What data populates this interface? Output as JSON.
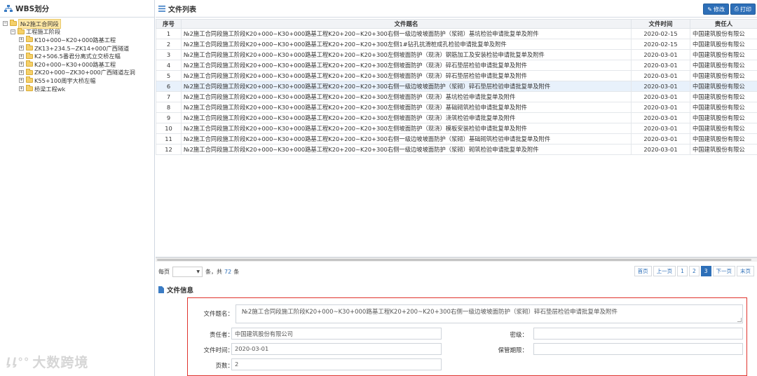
{
  "left": {
    "title": "WBS划分",
    "tree": {
      "root": "№2施工合同段",
      "child": "工程施工阶段",
      "items": [
        "K10+000~K20+000路基工程",
        "ZK13+234.5~ZK14+000广西隧道",
        "K2+506.5番君分离式立交桥左幅",
        "K20+000~K30+000路基工程",
        "ZK20+000~ZK30+000广西隧道左洞",
        "K55+100周宇大桥左幅",
        "桥梁工程wk"
      ]
    },
    "watermark": "大数跨境"
  },
  "list": {
    "title": "文件列表",
    "edit_label": "修改",
    "print_label": "打印",
    "columns": [
      "序号",
      "文件题名",
      "文件时间",
      "责任人"
    ],
    "rows": [
      {
        "idx": "1",
        "name": "№2施工合同段施工阶段K20+000~K30+000路基工程K20+200~K20+300右侧一级边坡坡面防护（浆砌）基坑检验申请批复单及附件",
        "date": "2020-02-15",
        "owner": "中国建筑股份有限公"
      },
      {
        "idx": "2",
        "name": "№2施工合同段施工阶段K20+000~K30+000路基工程K20+200~K20+300左侧1#钻孔抗滑桩成孔检验申请批复单及附件",
        "date": "2020-02-15",
        "owner": "中国建筑股份有限公"
      },
      {
        "idx": "3",
        "name": "№2施工合同段施工阶段K20+000~K30+000路基工程K20+200~K20+300左侧坡面防护（现浇）钢筋加工及安装检验申请批复单及附件",
        "date": "2020-03-01",
        "owner": "中国建筑股份有限公"
      },
      {
        "idx": "4",
        "name": "№2施工合同段施工阶段K20+000~K30+000路基工程K20+200~K20+300左侧坡面防护（现浇）碎石垫层检验申请批复单及附件",
        "date": "2020-03-01",
        "owner": "中国建筑股份有限公"
      },
      {
        "idx": "5",
        "name": "№2施工合同段施工阶段K20+000~K30+000路基工程K20+200~K20+300左侧坡面防护（现浇）碎石垫层检验申请批复单及附件",
        "date": "2020-03-01",
        "owner": "中国建筑股份有限公"
      },
      {
        "idx": "6",
        "name": "№2施工合同段施工阶段K20+000~K30+000路基工程K20+200~K20+300右侧一级边坡坡面防护（浆砌）碎石垫层检验申请批复单及附件",
        "date": "2020-03-01",
        "owner": "中国建筑股份有限公"
      },
      {
        "idx": "7",
        "name": "№2施工合同段施工阶段K20+000~K30+000路基工程K20+200~K20+300左侧坡面防护（现浇）基坑检验申请批复单及附件",
        "date": "2020-03-01",
        "owner": "中国建筑股份有限公"
      },
      {
        "idx": "8",
        "name": "№2施工合同段施工阶段K20+000~K30+000路基工程K20+200~K20+300左侧坡面防护（现浇）基础砌筑检验申请批复单及附件",
        "date": "2020-03-01",
        "owner": "中国建筑股份有限公"
      },
      {
        "idx": "9",
        "name": "№2施工合同段施工阶段K20+000~K30+000路基工程K20+200~K20+300左侧坡面防护（现浇）浇筑检验申请批复单及附件",
        "date": "2020-03-01",
        "owner": "中国建筑股份有限公"
      },
      {
        "idx": "10",
        "name": "№2施工合同段施工阶段K20+000~K30+000路基工程K20+200~K20+300左侧坡面防护（现浇）模板安装检验申请批复单及附件",
        "date": "2020-03-01",
        "owner": "中国建筑股份有限公"
      },
      {
        "idx": "11",
        "name": "№2施工合同段施工阶段K20+000~K30+000路基工程K20+200~K20+300右侧一级边坡坡面防护（浆砌）基础砌筑检验申请批复单及附件",
        "date": "2020-03-01",
        "owner": "中国建筑股份有限公"
      },
      {
        "idx": "12",
        "name": "№2施工合同段施工阶段K20+000~K30+000路基工程K20+200~K20+300右侧一级边坡坡面防护（浆砌）砌筑检验申请批复单及附件",
        "date": "2020-03-01",
        "owner": "中国建筑股份有限公"
      }
    ],
    "selected_row": 6
  },
  "pager": {
    "per_page_label": "每页",
    "per_page_value": "",
    "unit": "条，共",
    "total": "72",
    "total_unit": "条",
    "first": "首页",
    "prev": "上一页",
    "pages": [
      "1",
      "2",
      "3"
    ],
    "current_page": "3",
    "next": "下一页",
    "last": "末页"
  },
  "info": {
    "title": "文件信息",
    "name_label": "文件题名：",
    "name_value": "№2施工合同段施工阶段K20+000~K30+000路基工程K20+200~K20+300右侧一级边坡坡面防护（浆砌）碎石垫层检验申请批复单及附件",
    "owner_label": "责任者：",
    "owner_value": "中国建筑股份有限公司",
    "secret_label": "密级：",
    "secret_value": "",
    "date_label": "文件时间：",
    "date_value": "2020-03-01",
    "retention_label": "保管期限：",
    "retention_value": "",
    "pages_label": "页数：",
    "pages_value": "2"
  },
  "colors": {
    "accent": "#2d6fb8",
    "highlight_border": "#e0342e",
    "selected_row": "#e8f1fb"
  }
}
